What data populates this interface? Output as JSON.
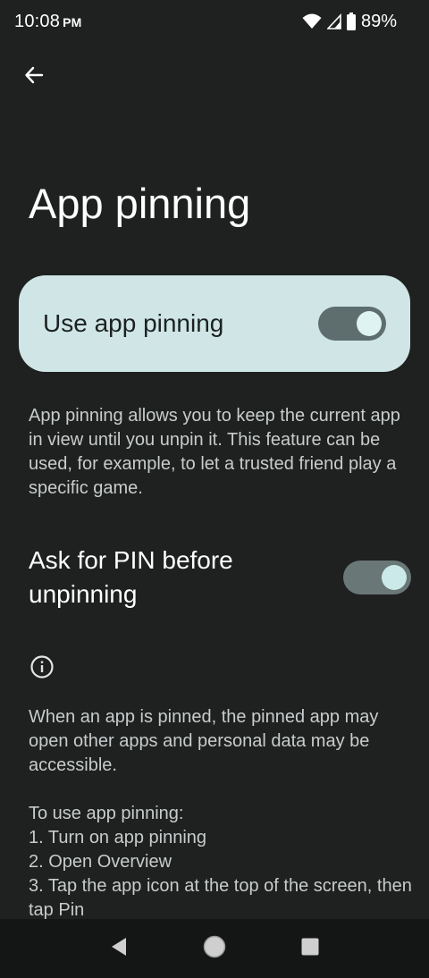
{
  "status_bar": {
    "time": "10:08",
    "ampm": "PM",
    "battery_percent": "89%"
  },
  "header": {
    "back_icon": "arrow-back-icon",
    "title": "App pinning"
  },
  "main_switch": {
    "label": "Use app pinning",
    "enabled": true
  },
  "description": "App pinning allows you to keep the current app in view until you unpin it. This feature can be used, for example, to let a trusted friend play a specific game.",
  "pin_setting": {
    "label": "Ask for PIN before unpinning",
    "enabled": true
  },
  "footer": {
    "info_icon": "info-icon",
    "warning": "When an app is pinned, the pinned app may open other apps and personal data may be accessible.",
    "steps_title": "To use app pinning:",
    "steps": [
      "1. Turn on app pinning",
      "2. Open Overview",
      "3. Tap the app icon at the top of the screen, then tap Pin"
    ]
  },
  "nav_bar": {
    "icons": [
      "back-triangle-icon",
      "home-circle-icon",
      "recents-square-icon"
    ]
  },
  "colors": {
    "background": "#1f2020",
    "card": "#d0e6e6",
    "toggle_track": "#5e6e6e",
    "toggle_thumb": "#dff3f3"
  }
}
